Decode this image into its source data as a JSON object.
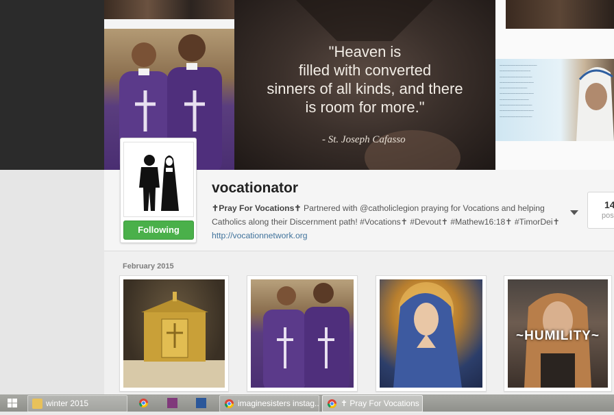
{
  "banner": {
    "quote_lines": [
      "\"Heaven is",
      "filled with converted",
      "sinners of all kinds, and there",
      "is room for more.\""
    ],
    "quote_signature": "- St. Joseph Cafasso"
  },
  "profile": {
    "username": "vocationator",
    "follow_button": "Following",
    "bio_title": "✝Pray For Vocations✝",
    "bio_text": " Partnered with @catholiclegion praying for Vocations and helping Catholics along their Discernment path! #Vocations✝ #Devout✝ #Mathew16:18✝ #TimorDei✝ ",
    "bio_link": "http://vocationnetwork.org",
    "stat_number": "14",
    "stat_label": "pos"
  },
  "feed": {
    "month_label": "February 2015",
    "thumbnails": [
      {
        "name": "tabernacle-photo"
      },
      {
        "name": "priests-photo"
      },
      {
        "name": "madonna-painting"
      },
      {
        "name": "humility-photo",
        "caption": "~HUMILITY~"
      }
    ]
  },
  "taskbar": {
    "items": [
      {
        "label": "winter 2015",
        "icon": "folder-icon",
        "color": "#e8c15a"
      },
      {
        "label": "imaginesisters instag...",
        "icon": "chrome-icon",
        "color": "#d9d9d9"
      },
      {
        "label": "✝ Pray For Vocations ...",
        "icon": "chrome-icon",
        "color": "#d9d9d9"
      }
    ],
    "pinned": [
      {
        "icon": "chrome-icon"
      },
      {
        "icon": "onenote-icon",
        "color": "#80397b"
      },
      {
        "icon": "word-icon",
        "color": "#2b579a"
      }
    ]
  },
  "colors": {
    "follow_green": "#4ab04a",
    "link_blue": "#3f729b"
  }
}
